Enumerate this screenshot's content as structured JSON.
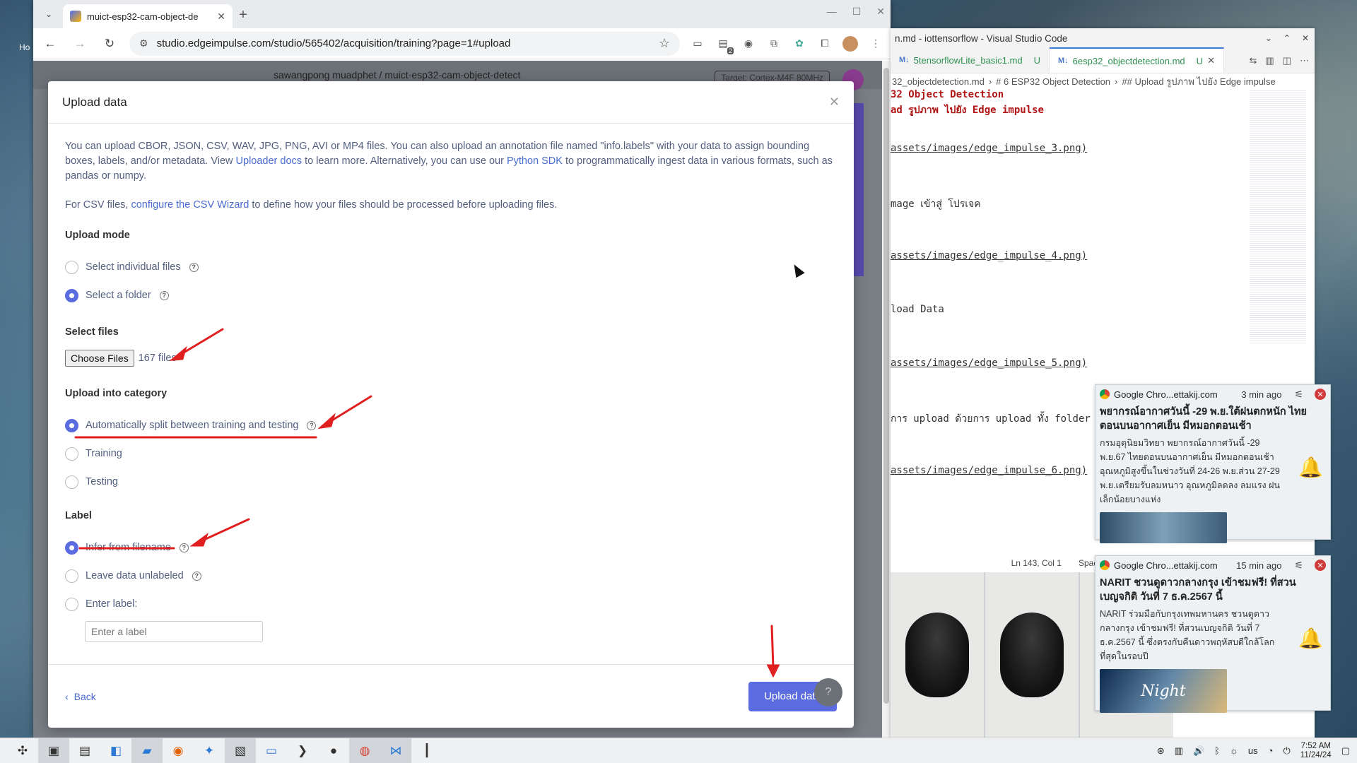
{
  "desktop": {
    "label": "Ho"
  },
  "chrome": {
    "tab_title": "muict-esp32-cam-object-de",
    "url": "studio.edgeimpulse.com/studio/565402/acquisition/training?page=1#upload",
    "ext_badge": "2",
    "page_header": "sawangpong muadphet  /  muict-esp32-cam-object-detect",
    "target": "Target: Cortex-M4F 80MHz"
  },
  "modal": {
    "title": "Upload data",
    "intro_before_link1": "You can upload CBOR, JSON, CSV, WAV, JPG, PNG, AVI or MP4 files. You can also upload an annotation file named \"info.labels\" with your data to assign bounding boxes, labels, and/or metadata. View ",
    "intro_link1": "Uploader docs",
    "intro_between": " to learn more. Alternatively, you can use our ",
    "intro_link2": "Python SDK",
    "intro_after": " to programmatically ingest data in various formats, such as pandas or numpy.",
    "csv_before": "For CSV files, ",
    "csv_link": "configure the CSV Wizard",
    "csv_after": " to define how your files should be processed before uploading files.",
    "upload_mode_title": "Upload mode",
    "upload_modes": [
      "Select individual files",
      "Select a folder"
    ],
    "select_files_title": "Select files",
    "choose_files_label": "Choose Files",
    "file_count": "167 files",
    "category_title": "Upload into category",
    "categories": [
      "Automatically split between training and testing",
      "Training",
      "Testing"
    ],
    "label_title": "Label",
    "label_options": [
      "Infer from filename",
      "Leave data unlabeled",
      "Enter label:"
    ],
    "label_placeholder": "Enter a label",
    "back_label": "Back",
    "upload_label": "Upload data"
  },
  "vscode": {
    "title": "n.md - iottensorflow - Visual Studio Code",
    "tabs": [
      {
        "name": "5tensorflowLite_basic1.md",
        "status": "U"
      },
      {
        "name": "6esp32_objectdetection.md",
        "status": "U"
      }
    ],
    "breadcrumb": [
      "32_objectdetection.md",
      "# 6 ESP32 Object Detection",
      "## Upload รูปภาพ ไปยัง Edge impulse"
    ],
    "lines": [
      {
        "text": "32 Object Detection",
        "kind": "h"
      },
      {
        "text": "ad รูปภาพ ไปยัง Edge impulse",
        "kind": "h"
      },
      {
        "text": "",
        "kind": ""
      },
      {
        "text": "assets/images/edge_impulse_3.png)",
        "kind": "u"
      },
      {
        "text": "",
        "kind": ""
      },
      {
        "text": "mage เข้าสู่ โปรเจค",
        "kind": ""
      },
      {
        "text": "",
        "kind": ""
      },
      {
        "text": "assets/images/edge_impulse_4.png)",
        "kind": "u"
      },
      {
        "text": "",
        "kind": ""
      },
      {
        "text": "load Data",
        "kind": ""
      },
      {
        "text": "",
        "kind": ""
      },
      {
        "text": "assets/images/edge_impulse_5.png)",
        "kind": "u"
      },
      {
        "text": "",
        "kind": ""
      },
      {
        "text": "การ upload ด้วยการ upload ทั้ง folder",
        "kind": ""
      },
      {
        "text": "",
        "kind": ""
      },
      {
        "text": "assets/images/edge_impulse_6.png)",
        "kind": "u"
      }
    ],
    "status_pos": "Ln 143, Col 1",
    "status_space": "Space"
  },
  "notifications": [
    {
      "source": "Google Chro...ettakij.com",
      "ago": "3 min ago",
      "title": "พยากรณ์อากาศวันนี้ -29 พ.ย.ใต้ฝนตกหนัก ไทยตอนบนอากาศเย็น มีหมอกตอนเช้า",
      "body": "กรมอุตุนิยมวิทยา พยากรณ์อากาศวันนี้ -29 พ.ย.67 ไทยตอนบนอากาศเย็น มีหมอกตอนเช้า อุณหภูมิสูงขึ้นในช่วงวันที่ 24-26 พ.ย.ส่วน 27-29 พ.ย.เตรียมรับลมหนาว อุณหภูมิลดลง ลมแรง ฝนเล็กน้อยบางแห่ง"
    },
    {
      "source": "Google Chro...ettakij.com",
      "ago": "15 min ago",
      "title": "NARIT ชวนดูดาวกลางกรุง เข้าชมฟรี! ที่สวนเบญจกิติ วันที่ 7 ธ.ค.2567 นี้",
      "body": "NARIT ร่วมมือกับกรุงเทพมหานคร ชวนดูดาวกลางกรุง เข้าชมฟรี! ที่สวนเบญจกิติ วันที่ 7 ธ.ค.2567 นี้ ซึ่งตรงกับคืนดาวพฤหัสบดีใกล้โลกที่สุดในรอบปี",
      "image_text": "Night"
    }
  ],
  "taskbar": {
    "lang": "us",
    "time": "7:52 AM",
    "date": "11/24/24"
  },
  "colors": {
    "accent": "#5b6be0",
    "link": "#4a6bd1",
    "annotation": "#e02020"
  }
}
